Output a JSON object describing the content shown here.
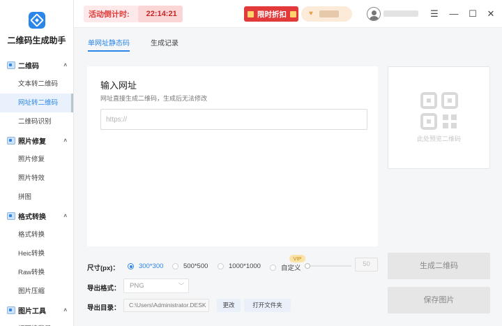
{
  "app": {
    "title": "二维码生成助手"
  },
  "sidebar": {
    "groups": [
      {
        "label": "二维码",
        "chevron": "˄",
        "items": [
          "文本转二维码",
          "网址转二维码",
          "二维码识别"
        ]
      },
      {
        "label": "照片修复",
        "chevron": "˄",
        "items": [
          "照片修复",
          "照片特效",
          "拼图"
        ]
      },
      {
        "label": "格式转换",
        "chevron": "˄",
        "items": [
          "格式转换",
          "Heic转换",
          "Raw转换",
          "图片压缩"
        ]
      },
      {
        "label": "图片工具",
        "chevron": "˄",
        "items": [
          "抠图换背景"
        ]
      }
    ],
    "active_item": "网址转二维码"
  },
  "topbar": {
    "countdown_label": "活动倒计时:",
    "countdown_time": "22:14:21",
    "promo_label": "限时折扣",
    "window_controls": {
      "menu": "☰",
      "minimize": "—",
      "maximize": "☐",
      "close": "✕"
    }
  },
  "tabs": [
    {
      "label": "单网址静态码",
      "active": true
    },
    {
      "label": "生成记录",
      "active": false
    }
  ],
  "input_panel": {
    "title": "输入网址",
    "hint": "网址直接生成二维码，生成后无法修改",
    "url_placeholder": "https://",
    "url_value": ""
  },
  "preview": {
    "caption": "此处预览二维码",
    "icon": "qr-code-icon"
  },
  "size": {
    "label": "尺寸(px)：",
    "options": [
      "300*300",
      "500*500",
      "1000*1000",
      "自定义"
    ],
    "selected": "300*300",
    "vip_badge": "VIP",
    "custom_value": "50"
  },
  "format": {
    "label": "导出格式：",
    "value": "PNG"
  },
  "directory": {
    "label": "导出目录：",
    "path": "C:\\Users\\Administrator.DESK",
    "change_label": "更改",
    "open_label": "打开文件夹"
  },
  "actions": {
    "generate_label": "生成二维码",
    "save_label": "保存图片"
  },
  "colors": {
    "accent": "#2a86e8",
    "countdown": "#e23a3a",
    "promo_bg": "#e23a3a",
    "vip_bg": "#fcebd8"
  }
}
